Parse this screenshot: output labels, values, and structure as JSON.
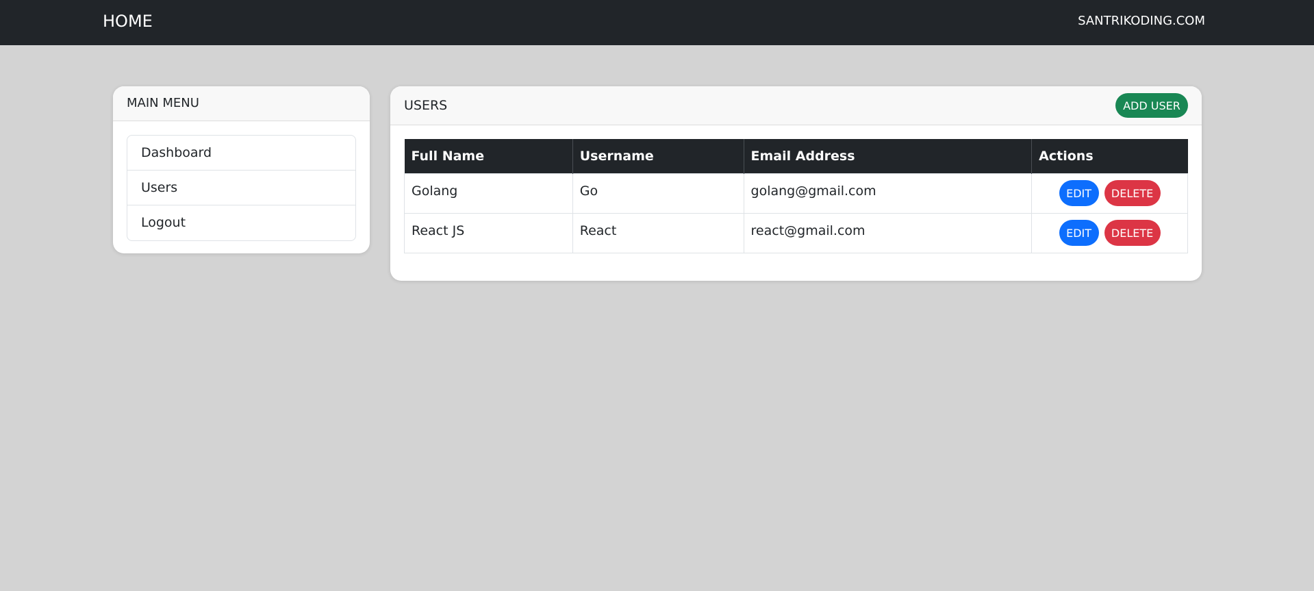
{
  "navbar": {
    "brand": "HOME",
    "right_link": "SANTRIKODING.COM"
  },
  "sidebar": {
    "title": "MAIN MENU",
    "items": [
      {
        "label": "Dashboard"
      },
      {
        "label": "Users"
      },
      {
        "label": "Logout"
      }
    ]
  },
  "users": {
    "title": "USERS",
    "add_label": "ADD USER",
    "columns": [
      "Full Name",
      "Username",
      "Email Address",
      "Actions"
    ],
    "rows": [
      {
        "full_name": "Golang",
        "username": "Go",
        "email": "golang@gmail.com",
        "edit_label": "EDIT",
        "delete_label": "DELETE"
      },
      {
        "full_name": "React JS",
        "username": "React",
        "email": "react@gmail.com",
        "edit_label": "EDIT",
        "delete_label": "DELETE"
      }
    ]
  },
  "colors": {
    "navbar_bg": "#212529",
    "page_bg": "#d3d3d3",
    "add_button": "#198754",
    "edit_button": "#0d6efd",
    "delete_button": "#dc3545"
  }
}
